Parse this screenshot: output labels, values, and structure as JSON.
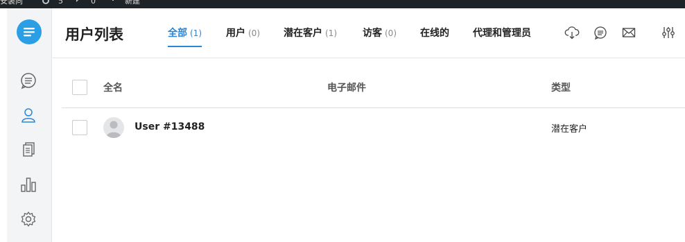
{
  "adminbar": {
    "items": [
      "安装向",
      "5",
      "0",
      "新建"
    ]
  },
  "page": {
    "title": "用户列表"
  },
  "tabs": [
    {
      "label": "全部",
      "count": "(1)",
      "active": true
    },
    {
      "label": "用户",
      "count": "(0)"
    },
    {
      "label": "潜在客户",
      "count": "(1)"
    },
    {
      "label": "访客",
      "count": "(0)"
    },
    {
      "label": "在线的",
      "count": ""
    },
    {
      "label": "代理和管理员",
      "count": ""
    }
  ],
  "header_icons": [
    "cloud-download-icon",
    "chat-bubble-icon",
    "mail-icon",
    "filter-sliders-icon"
  ],
  "rail_icons": [
    "chat-icon",
    "user-icon",
    "documents-icon",
    "bar-chart-icon",
    "settings-gear-icon"
  ],
  "table": {
    "columns": [
      "全名",
      "电子邮件",
      "类型"
    ],
    "rows": [
      {
        "name": "User #13488",
        "email": "",
        "type": "潜在客户"
      }
    ]
  },
  "colors": {
    "accent": "#2a86d9",
    "logo": "#2a9fe6",
    "adminbar": "#1d2327"
  }
}
